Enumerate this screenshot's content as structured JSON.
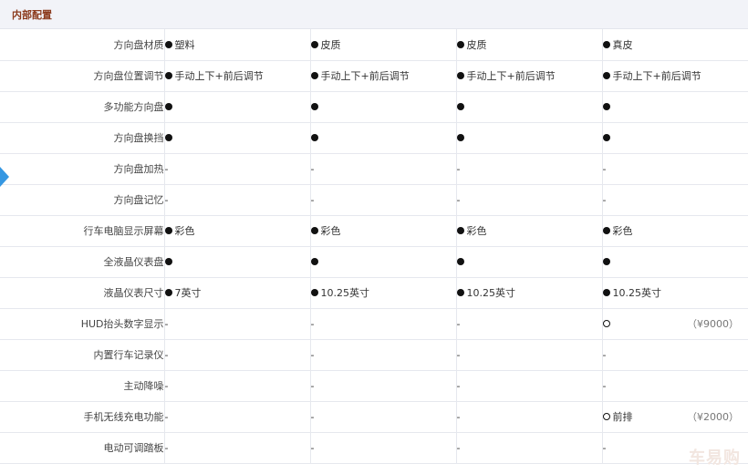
{
  "section": {
    "title": "内部配置"
  },
  "rows": [
    {
      "label": "方向盘材质",
      "cells": [
        {
          "sym": "filled",
          "text": "塑料",
          "price": ""
        },
        {
          "sym": "filled",
          "text": "皮质",
          "price": ""
        },
        {
          "sym": "filled",
          "text": "皮质",
          "price": ""
        },
        {
          "sym": "filled",
          "text": "真皮",
          "price": ""
        }
      ]
    },
    {
      "label": "方向盘位置调节",
      "cells": [
        {
          "sym": "filled",
          "text": "手动上下+前后调节",
          "price": ""
        },
        {
          "sym": "filled",
          "text": "手动上下+前后调节",
          "price": ""
        },
        {
          "sym": "filled",
          "text": "手动上下+前后调节",
          "price": ""
        },
        {
          "sym": "filled",
          "text": "手动上下+前后调节",
          "price": ""
        }
      ]
    },
    {
      "label": "多功能方向盘",
      "cells": [
        {
          "sym": "filled",
          "text": "",
          "price": ""
        },
        {
          "sym": "filled",
          "text": "",
          "price": ""
        },
        {
          "sym": "filled",
          "text": "",
          "price": ""
        },
        {
          "sym": "filled",
          "text": "",
          "price": ""
        }
      ]
    },
    {
      "label": "方向盘换挡",
      "cells": [
        {
          "sym": "filled",
          "text": "",
          "price": ""
        },
        {
          "sym": "filled",
          "text": "",
          "price": ""
        },
        {
          "sym": "filled",
          "text": "",
          "price": ""
        },
        {
          "sym": "filled",
          "text": "",
          "price": ""
        }
      ]
    },
    {
      "label": "方向盘加热",
      "cells": [
        {
          "sym": "",
          "text": "-",
          "price": ""
        },
        {
          "sym": "",
          "text": "-",
          "price": ""
        },
        {
          "sym": "",
          "text": "-",
          "price": ""
        },
        {
          "sym": "",
          "text": "-",
          "price": ""
        }
      ]
    },
    {
      "label": "方向盘记忆",
      "cells": [
        {
          "sym": "",
          "text": "-",
          "price": ""
        },
        {
          "sym": "",
          "text": "-",
          "price": ""
        },
        {
          "sym": "",
          "text": "-",
          "price": ""
        },
        {
          "sym": "",
          "text": "-",
          "price": ""
        }
      ]
    },
    {
      "label": "行车电脑显示屏幕",
      "cells": [
        {
          "sym": "filled",
          "text": "彩色",
          "price": ""
        },
        {
          "sym": "filled",
          "text": "彩色",
          "price": ""
        },
        {
          "sym": "filled",
          "text": "彩色",
          "price": ""
        },
        {
          "sym": "filled",
          "text": "彩色",
          "price": ""
        }
      ]
    },
    {
      "label": "全液晶仪表盘",
      "cells": [
        {
          "sym": "filled",
          "text": "",
          "price": ""
        },
        {
          "sym": "filled",
          "text": "",
          "price": ""
        },
        {
          "sym": "filled",
          "text": "",
          "price": ""
        },
        {
          "sym": "filled",
          "text": "",
          "price": ""
        }
      ]
    },
    {
      "label": "液晶仪表尺寸",
      "cells": [
        {
          "sym": "filled",
          "text": "7英寸",
          "price": ""
        },
        {
          "sym": "filled",
          "text": "10.25英寸",
          "price": ""
        },
        {
          "sym": "filled",
          "text": "10.25英寸",
          "price": ""
        },
        {
          "sym": "filled",
          "text": "10.25英寸",
          "price": ""
        }
      ]
    },
    {
      "label": "HUD抬头数字显示",
      "cells": [
        {
          "sym": "",
          "text": "-",
          "price": ""
        },
        {
          "sym": "",
          "text": "-",
          "price": ""
        },
        {
          "sym": "",
          "text": "-",
          "price": ""
        },
        {
          "sym": "hollow",
          "text": "",
          "price": "（¥9000）"
        }
      ]
    },
    {
      "label": "内置行车记录仪",
      "cells": [
        {
          "sym": "",
          "text": "-",
          "price": ""
        },
        {
          "sym": "",
          "text": "-",
          "price": ""
        },
        {
          "sym": "",
          "text": "-",
          "price": ""
        },
        {
          "sym": "",
          "text": "-",
          "price": ""
        }
      ]
    },
    {
      "label": "主动降噪",
      "cells": [
        {
          "sym": "",
          "text": "-",
          "price": ""
        },
        {
          "sym": "",
          "text": "-",
          "price": ""
        },
        {
          "sym": "",
          "text": "-",
          "price": ""
        },
        {
          "sym": "",
          "text": "-",
          "price": ""
        }
      ]
    },
    {
      "label": "手机无线充电功能",
      "cells": [
        {
          "sym": "",
          "text": "-",
          "price": ""
        },
        {
          "sym": "",
          "text": "-",
          "price": ""
        },
        {
          "sym": "",
          "text": "-",
          "price": ""
        },
        {
          "sym": "hollow",
          "text": "前排",
          "price": "（¥2000）"
        }
      ]
    },
    {
      "label": "电动可调踏板",
      "cells": [
        {
          "sym": "",
          "text": "-",
          "price": ""
        },
        {
          "sym": "",
          "text": "-",
          "price": ""
        },
        {
          "sym": "",
          "text": "-",
          "price": ""
        },
        {
          "sym": "",
          "text": "-",
          "price": ""
        }
      ]
    }
  ],
  "watermark": "车易购",
  "colors": {
    "header_bg": "#f2f3f8",
    "title": "#8b3a1c",
    "arrow": "#3597e2",
    "border": "#e6e8ee"
  },
  "icons": {
    "filled": "standard-equipment-dot-icon",
    "hollow": "optional-equipment-circle-icon",
    "arrow": "nav-arrow-icon"
  }
}
